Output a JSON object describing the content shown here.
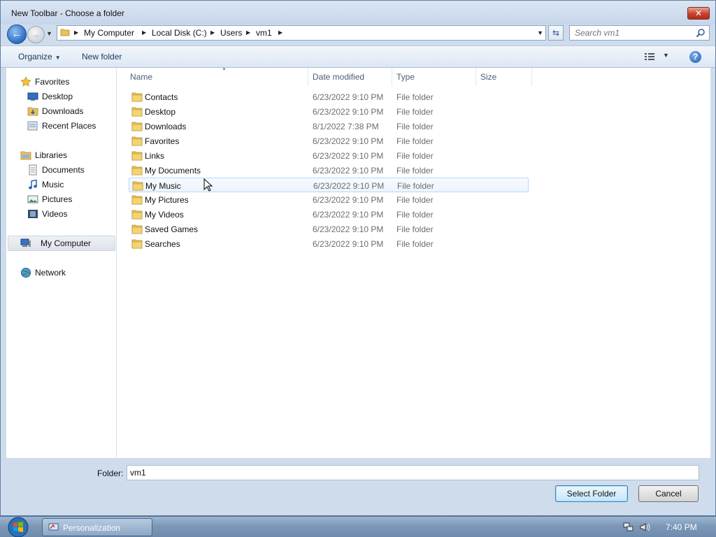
{
  "window": {
    "title": "New Toolbar - Choose a folder",
    "close_label": "✕"
  },
  "address": {
    "crumbs": [
      "My Computer",
      "Local Disk (C:)",
      "Users",
      "vm1"
    ],
    "search_placeholder": "Search vm1"
  },
  "toolbar": {
    "organize_label": "Organize",
    "new_folder_label": "New folder",
    "help_label": "?"
  },
  "nav": {
    "favorites": "Favorites",
    "favorites_items": [
      "Desktop",
      "Downloads",
      "Recent Places"
    ],
    "libraries": "Libraries",
    "libraries_items": [
      "Documents",
      "Music",
      "Pictures",
      "Videos"
    ],
    "computer": "My Computer",
    "network": "Network"
  },
  "columns": {
    "name": "Name",
    "date": "Date modified",
    "type": "Type",
    "size": "Size"
  },
  "files": [
    {
      "name": "Contacts",
      "date": "6/23/2022 9:10 PM",
      "type": "File folder"
    },
    {
      "name": "Desktop",
      "date": "6/23/2022 9:10 PM",
      "type": "File folder"
    },
    {
      "name": "Downloads",
      "date": "8/1/2022 7:38 PM",
      "type": "File folder"
    },
    {
      "name": "Favorites",
      "date": "6/23/2022 9:10 PM",
      "type": "File folder"
    },
    {
      "name": "Links",
      "date": "6/23/2022 9:10 PM",
      "type": "File folder"
    },
    {
      "name": "My Documents",
      "date": "6/23/2022 9:10 PM",
      "type": "File folder"
    },
    {
      "name": "My Music",
      "date": "6/23/2022 9:10 PM",
      "type": "File folder"
    },
    {
      "name": "My Pictures",
      "date": "6/23/2022 9:10 PM",
      "type": "File folder"
    },
    {
      "name": "My Videos",
      "date": "6/23/2022 9:10 PM",
      "type": "File folder"
    },
    {
      "name": "Saved Games",
      "date": "6/23/2022 9:10 PM",
      "type": "File folder"
    },
    {
      "name": "Searches",
      "date": "6/23/2022 9:10 PM",
      "type": "File folder"
    }
  ],
  "bottom": {
    "folder_label": "Folder:",
    "folder_value": "vm1",
    "select_label": "Select Folder",
    "cancel_label": "Cancel"
  },
  "taskbar": {
    "task_label": "Personalization",
    "clock": "7:40 PM"
  },
  "colors": {
    "folder_yellow": "#e8c25a",
    "accent_blue": "#2b6cc4"
  }
}
